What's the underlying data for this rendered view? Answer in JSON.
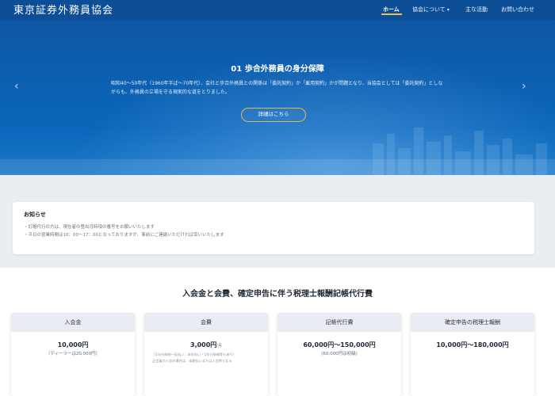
{
  "header": {
    "site_title": "東京証券外務員協会",
    "nav": [
      {
        "label": "ホーム",
        "active": true
      },
      {
        "label": "協会について",
        "dropdown": true
      },
      {
        "label": "主な活動"
      },
      {
        "label": "お問い合わせ"
      }
    ],
    "caret_icon": "chevron-down-icon"
  },
  "hero": {
    "title": "01 歩合外務員の身分保障",
    "body": "昭和40〜50年代（1960年半ば〜70年代）、会社と歩合外務員との関係は「委託契約」か「雇用契約」かが問題となり、当協会としては「委託契約」としながらも、外務員の立場を守る現実的な道をとりました。",
    "button_label": "詳細はこちら",
    "prev_icon": "chevron-left-icon",
    "next_icon": "chevron-right-icon"
  },
  "notice": {
    "title": "お知らせ",
    "items": [
      "・訂略代行の方は、現在者の登出月時頃の番号をお願いいたします",
      "・平日の営業時間は10：00〜17：00となっておりますが、事前にご連絡いただければ幸いいたします"
    ]
  },
  "fees": {
    "heading": "入会金と会費、確定申告に伴う税理士報酬記帳代行費",
    "cards": [
      {
        "title": "入会金",
        "price": "10,000円",
        "unit": "",
        "note": "（ディーラーは20,000円）",
        "small": []
      },
      {
        "title": "会費",
        "price": "3,000円",
        "unit": "/月",
        "note": "",
        "small": [
          "（1年分前納一括払い、半年払い・1年分前納等もあり）",
          "正会員の入会の場合は、半期払いまたは入会時となる"
        ]
      },
      {
        "title": "記帳代行費",
        "price": "60,000円〜150,000円",
        "unit": "",
        "note": "(60,000円は初級)",
        "small": []
      },
      {
        "title": "確定申告の税理士報酬",
        "price": "10,000円〜180,000円",
        "unit": "",
        "note": "",
        "small": []
      }
    ]
  },
  "colors": {
    "nav_bg": "#0d4f97",
    "hero_bg": "#0c5fb0",
    "accent": "#f2c14b",
    "card_head_bg": "#e9edf3"
  }
}
